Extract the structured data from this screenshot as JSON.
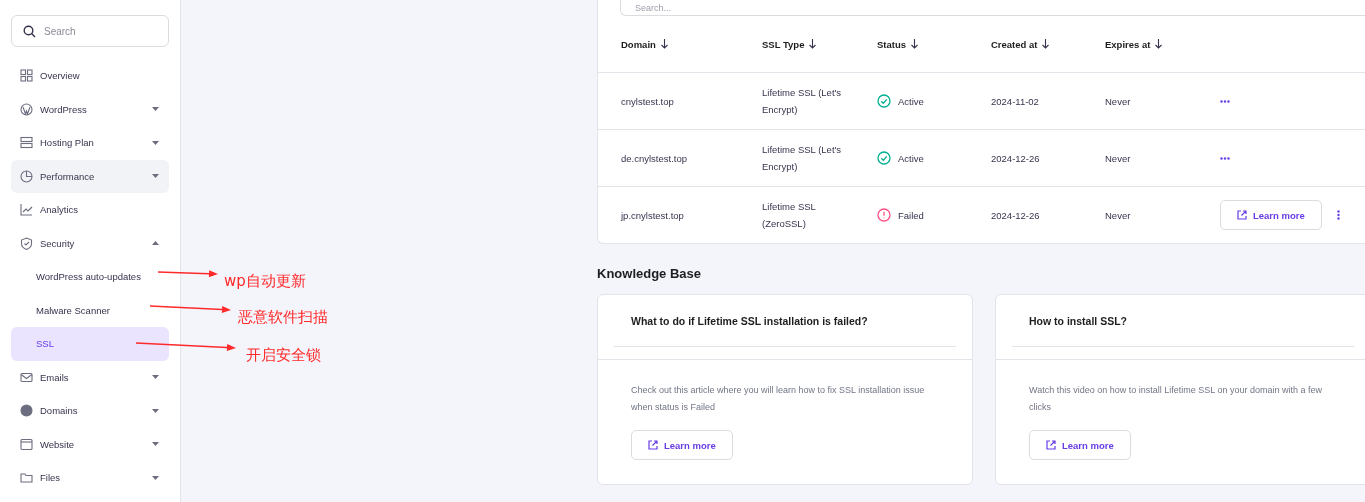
{
  "sidebar": {
    "search": {
      "placeholder": "Search"
    },
    "items": [
      {
        "kind": "link",
        "label": "Overview",
        "selected": false,
        "hovered": false
      },
      {
        "kind": "group",
        "label": "WordPress",
        "selected": false,
        "hovered": false,
        "expanded": false
      },
      {
        "kind": "group",
        "label": "Hosting Plan",
        "selected": false,
        "hovered": false,
        "expanded": false
      },
      {
        "kind": "group",
        "label": "Performance",
        "selected": false,
        "hovered": true,
        "expanded": false
      },
      {
        "kind": "link",
        "label": "Analytics",
        "selected": false,
        "hovered": false
      },
      {
        "kind": "group",
        "label": "Security",
        "selected": false,
        "hovered": false,
        "expanded": true,
        "children": [
          {
            "label": "WordPress auto-updates",
            "selected": false
          },
          {
            "label": "Malware Scanner",
            "selected": false
          },
          {
            "label": "SSL",
            "selected": true
          }
        ]
      },
      {
        "kind": "group",
        "label": "Emails",
        "selected": false,
        "hovered": false,
        "expanded": false
      },
      {
        "kind": "group",
        "label": "Domains",
        "selected": false,
        "hovered": false,
        "expanded": false
      },
      {
        "kind": "group",
        "label": "Website",
        "selected": false,
        "hovered": false,
        "expanded": false
      },
      {
        "kind": "group",
        "label": "Files",
        "selected": false,
        "hovered": false,
        "expanded": false
      }
    ]
  },
  "ssl_table": {
    "search": {
      "placeholder": "Search..."
    },
    "columns": [
      "Domain",
      "SSL Type",
      "Status",
      "Created at",
      "Expires at"
    ],
    "rows": [
      {
        "domain": "cnylstest.top",
        "ssl_type": "Lifetime SSL (Let's Encrypt)",
        "status": {
          "kind": "active",
          "label": "Active"
        },
        "created_at": "2024-11-02",
        "expires_at": "Never",
        "action": {
          "kind": "menu"
        }
      },
      {
        "domain": "de.cnylstest.top",
        "ssl_type": "Lifetime SSL (Let's Encrypt)",
        "status": {
          "kind": "active",
          "label": "Active"
        },
        "created_at": "2024-12-26",
        "expires_at": "Never",
        "action": {
          "kind": "menu"
        }
      },
      {
        "domain": "jp.cnylstest.top",
        "ssl_type": "Lifetime SSL (ZeroSSL)",
        "status": {
          "kind": "failed",
          "label": "Failed"
        },
        "created_at": "2024-12-26",
        "expires_at": "Never",
        "action": {
          "kind": "learn_more",
          "label": "Learn more"
        }
      }
    ]
  },
  "knowledge_base": {
    "title": "Knowledge Base",
    "articles": [
      {
        "title": "What to do if Lifetime SSL installation is failed?",
        "text": "Check out this article where you will learn how to fix SSL installation issue when status is Failed",
        "button": "Learn more"
      },
      {
        "title": "How to install SSL?",
        "text": "Watch this video on how to install Lifetime SSL on your domain with a few clicks",
        "button": "Learn more"
      }
    ]
  },
  "annotations": [
    {
      "label": "wp自动更新"
    },
    {
      "label": "恶意软件扫描"
    },
    {
      "label": "开启安全锁"
    }
  ]
}
